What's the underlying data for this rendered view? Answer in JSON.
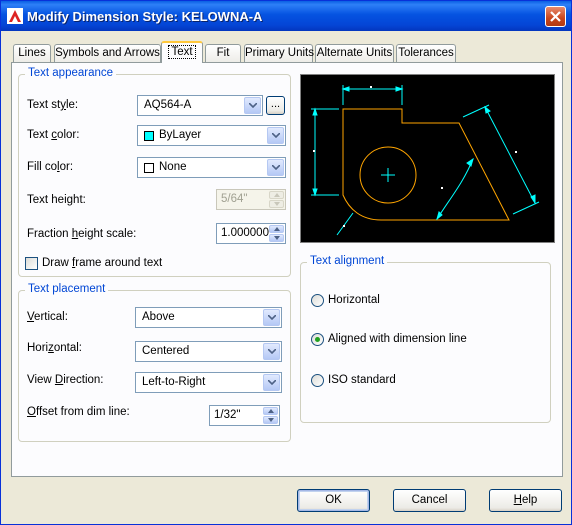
{
  "window": {
    "title": "Modify Dimension Style: KELOWNA-A"
  },
  "tabs": [
    {
      "label": "Lines"
    },
    {
      "label": "Symbols and Arrows"
    },
    {
      "label": "Text"
    },
    {
      "label": "Fit"
    },
    {
      "label": "Primary Units"
    },
    {
      "label": "Alternate Units"
    },
    {
      "label": "Tolerances"
    }
  ],
  "text_appearance": {
    "title": "Text appearance",
    "text_style": {
      "label_a": "Text st",
      "label_u": "y",
      "label_b": "le:",
      "value": "AQ564-A",
      "browse_label": "..."
    },
    "text_color": {
      "label_a": "Text ",
      "label_u": "c",
      "label_b": "olor:",
      "value": "ByLayer",
      "swatch_color": "#00ffff"
    },
    "fill_color": {
      "label_a": "Fill co",
      "label_u": "l",
      "label_b": "or:",
      "value": "None",
      "swatch_color": "#ffffff"
    },
    "text_height": {
      "label_a": "Text hei",
      "label_u": "g",
      "label_b": "ht:",
      "value": "5/64\""
    },
    "fraction_height_scale": {
      "label_a": "Fraction ",
      "label_u": "h",
      "label_b": "eight scale:",
      "value": "1.000000"
    },
    "draw_frame": {
      "label_a": "Draw ",
      "label_u": "f",
      "label_b": "rame around text",
      "checked": false
    }
  },
  "text_placement": {
    "title": "Text placement",
    "vertical": {
      "label_u": "V",
      "label_b": "ertical:",
      "value": "Above"
    },
    "horizontal": {
      "label_a": "Hori",
      "label_u": "z",
      "label_b": "ontal:",
      "value": "Centered"
    },
    "view_direction": {
      "label_a": "View ",
      "label_u": "D",
      "label_b": "irection:",
      "value": "Left-to-Right"
    },
    "offset": {
      "label_u": "O",
      "label_b": "ffset from dim line:",
      "value": "1/32\""
    }
  },
  "text_alignment": {
    "title_a": "Text ali",
    "title_u": "g",
    "title_b": "nment",
    "options": [
      {
        "label": "Horizontal",
        "selected": false
      },
      {
        "label": "Aligned with dimension line",
        "selected": true
      },
      {
        "label": "ISO standard",
        "selected": false
      }
    ]
  },
  "buttons": {
    "ok": "OK",
    "cancel": "Cancel",
    "help_u": "H",
    "help_b": "elp"
  },
  "colors": {
    "title_bar": "#0553e1",
    "accent": "#0046d5",
    "preview_dim": "#00ffff",
    "preview_geom": "#ffa500"
  }
}
